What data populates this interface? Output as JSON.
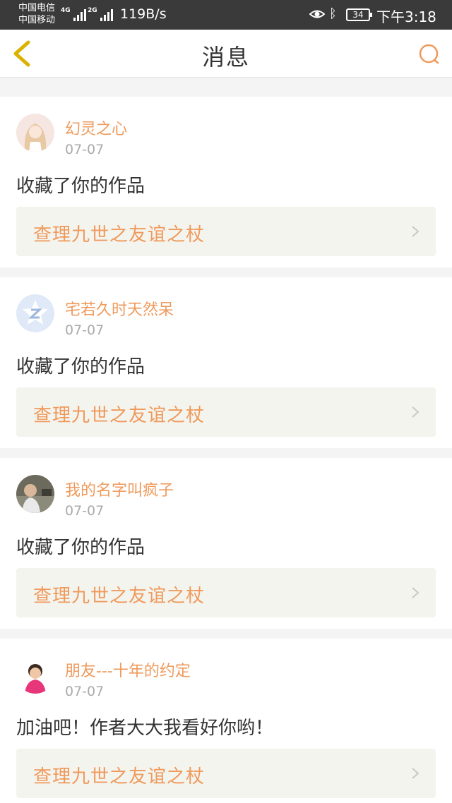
{
  "status_bar": {
    "carrier_1": "中国电信",
    "carrier_2": "中国移动",
    "net_4g": "4G",
    "net_2g": "2G",
    "net_speed": "119B/s",
    "battery": "34",
    "time": "下午3:18"
  },
  "nav": {
    "title": "消息",
    "back_icon": "chevron-left-icon",
    "search_icon": "search-icon"
  },
  "colors": {
    "accent": "#ef9a5c",
    "back_icon": "#d9b300",
    "work_bg": "#f4f4ee"
  },
  "messages": [
    {
      "user": "幻灵之心",
      "date": "07-07",
      "text": "收藏了你的作品",
      "work": "查理九世之友谊之杖"
    },
    {
      "user": "宅若久时天然呆",
      "date": "07-07",
      "text": "收藏了你的作品",
      "work": "查理九世之友谊之杖"
    },
    {
      "user": "我的名字叫疯子",
      "date": "07-07",
      "text": "收藏了你的作品",
      "work": "查理九世之友谊之杖"
    },
    {
      "user": "朋友---十年的约定",
      "date": "07-07",
      "text": "加油吧！作者大大我看好你哟！",
      "work": "查理九世之友谊之杖"
    }
  ]
}
